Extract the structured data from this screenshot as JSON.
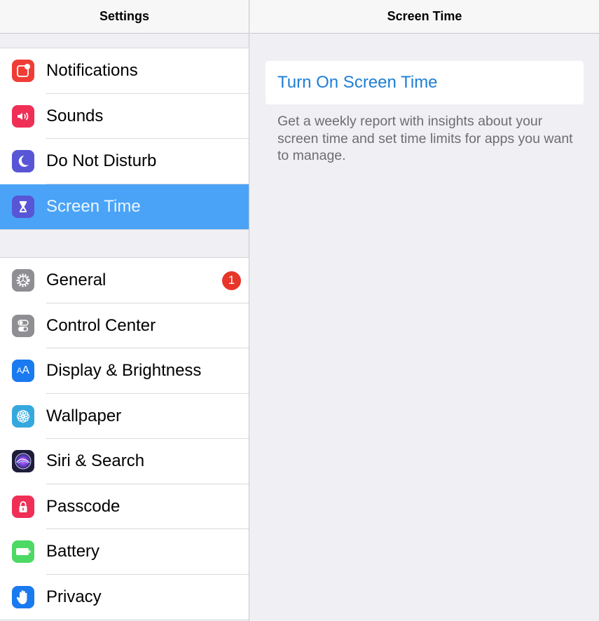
{
  "left_panel": {
    "title": "Settings",
    "groups": [
      {
        "items": [
          {
            "label": "Notifications",
            "icon": "notifications-icon",
            "color": "#ef3d36"
          },
          {
            "label": "Sounds",
            "icon": "sounds-icon",
            "color": "#ef2f56"
          },
          {
            "label": "Do Not Disturb",
            "icon": "moon-icon",
            "color": "#5856d6"
          },
          {
            "label": "Screen Time",
            "icon": "hourglass-icon",
            "color": "#5856d6",
            "selected": true
          }
        ]
      },
      {
        "items": [
          {
            "label": "General",
            "icon": "gear-icon",
            "color": "#8e8e93",
            "badge": "1"
          },
          {
            "label": "Control Center",
            "icon": "toggles-icon",
            "color": "#8e8e93"
          },
          {
            "label": "Display & Brightness",
            "icon": "text-size-icon",
            "color": "#1a7af0",
            "glyph": "AA"
          },
          {
            "label": "Wallpaper",
            "icon": "flower-icon",
            "color": "#35a9de"
          },
          {
            "label": "Siri & Search",
            "icon": "siri-icon",
            "color": "#1d1d3a"
          },
          {
            "label": "Passcode",
            "icon": "lock-icon",
            "color": "#ef2f56"
          },
          {
            "label": "Battery",
            "icon": "battery-icon",
            "color": "#4cd964"
          },
          {
            "label": "Privacy",
            "icon": "hand-icon",
            "color": "#1a7af0"
          }
        ]
      }
    ],
    "selection_color": "#4aa3f7",
    "badge_color": "#e8352a"
  },
  "right_panel": {
    "title": "Screen Time",
    "action_label": "Turn On Screen Time",
    "action_color": "#1e7ed6",
    "description": "Get a weekly report with insights about your screen time and set time limits for apps you want to manage."
  }
}
